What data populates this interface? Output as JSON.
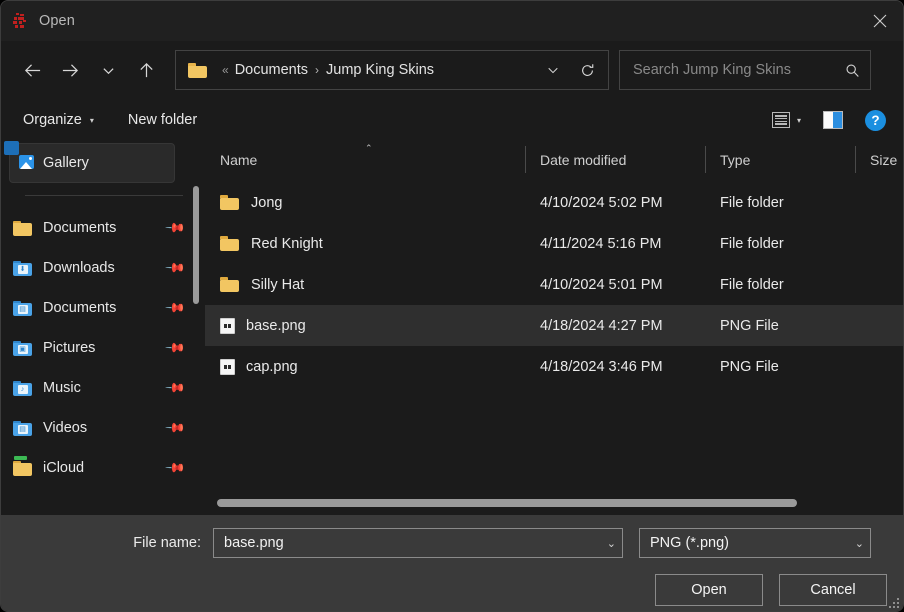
{
  "window": {
    "title": "Open",
    "app_icon": "jumpking-app-icon",
    "close_label": "✕"
  },
  "nav": {
    "back_icon": "arrow-left-icon",
    "forward_icon": "arrow-right-icon",
    "recent_icon": "chevron-down-icon",
    "up_icon": "arrow-up-icon",
    "refresh_icon": "refresh-icon",
    "dropdown_icon": "chevron-down-icon"
  },
  "address": {
    "folder_icon": "folder-icon",
    "overflow": "«",
    "separator": "›",
    "crumbs": [
      "Documents",
      "Jump King Skins"
    ]
  },
  "search": {
    "placeholder": "Search Jump King Skins",
    "value": "",
    "icon": "search-icon"
  },
  "toolbar": {
    "organize_label": "Organize",
    "organize_caret": "▾",
    "new_folder_label": "New folder",
    "view_icon": "view-list-icon",
    "view_caret": "▾",
    "preview_pane_icon": "preview-pane-icon",
    "help_icon": "?"
  },
  "sidebar": {
    "gallery": {
      "label": "Gallery",
      "icon": "gallery-icon",
      "selected": true
    },
    "items": [
      {
        "label": "Documents",
        "icon": "folder-yellow-icon",
        "pinned": true
      },
      {
        "label": "Downloads",
        "icon": "folder-downloads-icon",
        "pinned": true
      },
      {
        "label": "Documents",
        "icon": "folder-documents-icon",
        "pinned": true
      },
      {
        "label": "Pictures",
        "icon": "folder-pictures-icon",
        "pinned": true
      },
      {
        "label": "Music",
        "icon": "folder-music-icon",
        "pinned": true
      },
      {
        "label": "Videos",
        "icon": "folder-videos-icon",
        "pinned": true
      },
      {
        "label": "iCloud",
        "icon": "folder-icloud-icon",
        "pinned": true
      }
    ],
    "pin_glyph": "📌"
  },
  "filelist": {
    "columns": [
      "Name",
      "Date modified",
      "Type",
      "Size"
    ],
    "sort_caret": "⌃",
    "rows": [
      {
        "name": "Jong",
        "date": "4/10/2024 5:02 PM",
        "type": "File folder",
        "size": "",
        "icon": "folder-yellow-icon",
        "selected": false
      },
      {
        "name": "Red Knight",
        "date": "4/11/2024 5:16 PM",
        "type": "File folder",
        "size": "",
        "icon": "folder-yellow-icon",
        "selected": false
      },
      {
        "name": "Silly Hat",
        "date": "4/10/2024 5:01 PM",
        "type": "File folder",
        "size": "",
        "icon": "folder-yellow-icon",
        "selected": false
      },
      {
        "name": "base.png",
        "date": "4/18/2024 4:27 PM",
        "type": "PNG File",
        "size": "",
        "icon": "png-file-icon",
        "selected": true
      },
      {
        "name": "cap.png",
        "date": "4/18/2024 3:46 PM",
        "type": "PNG File",
        "size": "",
        "icon": "png-file-icon",
        "selected": false
      }
    ]
  },
  "footer": {
    "file_name_label": "File name:",
    "file_name_value": "base.png",
    "filter_value": "PNG (*.png)",
    "chevron": "⌄",
    "open_label": "Open",
    "cancel_label": "Cancel"
  },
  "colors": {
    "window_bg": "#1b1b1b",
    "titlebar_bg": "#202020",
    "footer_bg": "#3a3a3a",
    "selection": "#2f2f2f",
    "accent_blue": "#1b8fe0",
    "folder_yellow": "#f2c662"
  }
}
